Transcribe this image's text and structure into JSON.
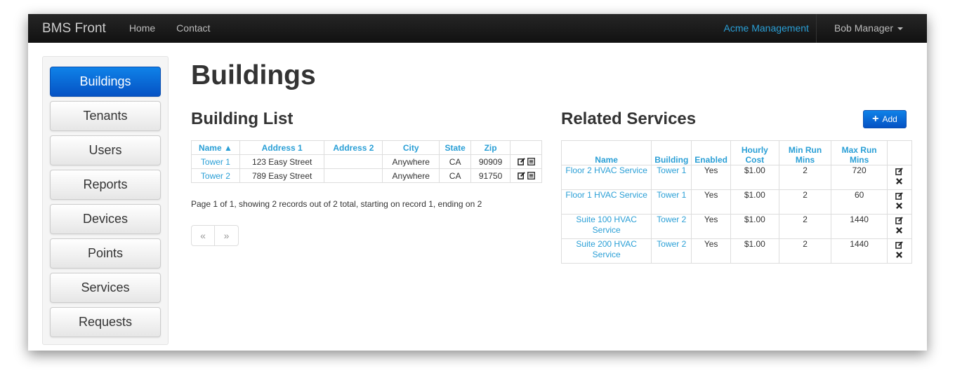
{
  "navbar": {
    "brand": "BMS Front",
    "links": [
      "Home",
      "Contact"
    ],
    "org": "Acme Management",
    "user": "Bob Manager"
  },
  "sidebar": {
    "items": [
      "Buildings",
      "Tenants",
      "Users",
      "Reports",
      "Devices",
      "Points",
      "Services",
      "Requests"
    ],
    "active": "Buildings"
  },
  "main": {
    "title": "Buildings",
    "building_list": {
      "title": "Building List",
      "columns": [
        "Name ▲",
        "Address 1",
        "Address 2",
        "City",
        "State",
        "Zip"
      ],
      "rows": [
        {
          "name": "Tower 1",
          "address1": "123 Easy Street",
          "address2": "",
          "city": "Anywhere",
          "state": "CA",
          "zip": "90909"
        },
        {
          "name": "Tower 2",
          "address1": "789 Easy Street",
          "address2": "",
          "city": "Anywhere",
          "state": "CA",
          "zip": "91750"
        }
      ],
      "pager_text": "Page 1 of 1, showing 2 records out of 2 total, starting on record 1, ending on 2",
      "pager_prev": "«",
      "pager_next": "»"
    },
    "related_services": {
      "title": "Related Services",
      "add_label": "Add",
      "columns": [
        "Name",
        "Building",
        "Enabled",
        "Hourly Cost",
        "Min Run Mins",
        "Max Run Mins"
      ],
      "rows": [
        {
          "name": "Floor 2 HVAC Service",
          "building": "Tower 1",
          "enabled": "Yes",
          "cost": "$1.00",
          "min": "2",
          "max": "720"
        },
        {
          "name": "Floor 1 HVAC Service",
          "building": "Tower 1",
          "enabled": "Yes",
          "cost": "$1.00",
          "min": "2",
          "max": "60"
        },
        {
          "name": "Suite 100 HVAC Service",
          "building": "Tower 2",
          "enabled": "Yes",
          "cost": "$1.00",
          "min": "2",
          "max": "1440"
        },
        {
          "name": "Suite 200 HVAC Service",
          "building": "Tower 2",
          "enabled": "Yes",
          "cost": "$1.00",
          "min": "2",
          "max": "1440"
        }
      ]
    }
  },
  "colors": {
    "link": "#2a9fd6",
    "primary": "#0552c4",
    "navbar": "#1a1a1a"
  },
  "icons": [
    "edit-icon",
    "list-icon",
    "delete-icon",
    "plus-icon",
    "caret-down-icon"
  ]
}
